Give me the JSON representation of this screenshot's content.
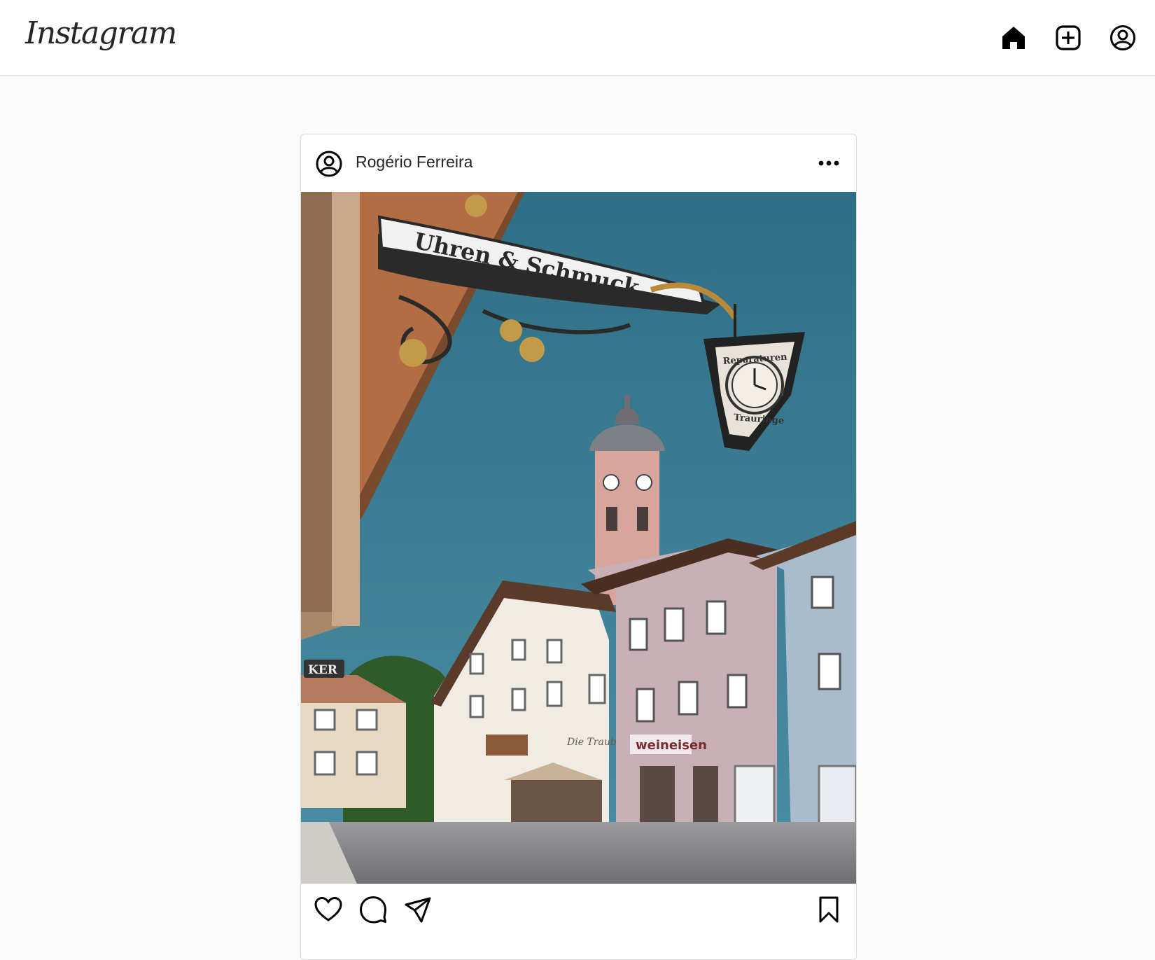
{
  "app": {
    "logo_text": "Instagram",
    "nav_icons": [
      "home-icon",
      "new-post-icon",
      "profile-icon"
    ]
  },
  "post": {
    "username": "Rogério Ferreira",
    "avatar_icon": "user-circle-icon",
    "more_icon": "more-options-icon",
    "photo": {
      "sign_text": "Uhren & Schmuck",
      "lantern_top_text": "Reparaturen",
      "lantern_bottom_text": "Trauringe",
      "shop_sign_text": "weineisen",
      "left_sign_text": "KER",
      "cafe_sign_text": "Die Traube"
    },
    "actions": [
      "like-icon",
      "comment-icon",
      "share-icon",
      "save-icon"
    ]
  },
  "colors": {
    "sky": "#3f7e93",
    "background": "#fafafa",
    "border": "#dbdbdb",
    "text": "#262626"
  }
}
